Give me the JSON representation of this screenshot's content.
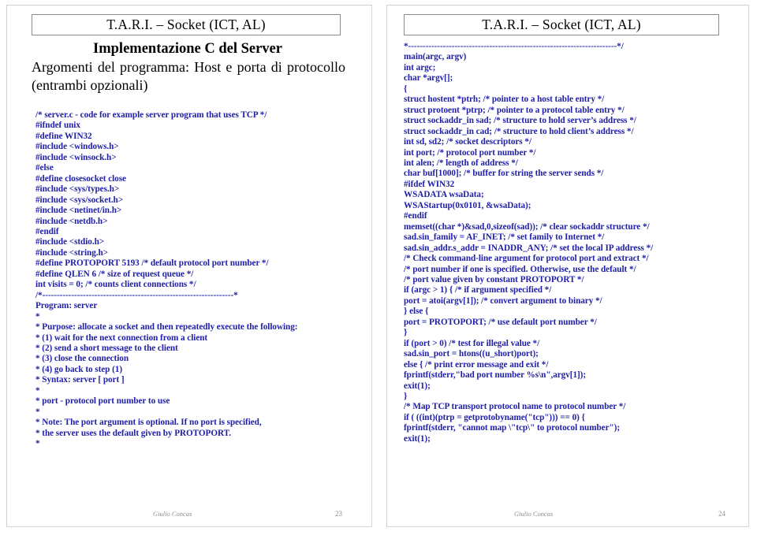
{
  "document": {
    "author": "Giulio Concas",
    "code_color": "#2020a8",
    "text_color": "#000000"
  },
  "slides": [
    {
      "header_title": "T.A.R.I. – Socket (ICT, AL)",
      "heading": "Implementazione C del Server",
      "subheading": "Argomenti del programma: Host e porta di protocollo (entrambi opzionali)",
      "page_number": "23",
      "author": "Giulio Concas",
      "code_lines": [
        "/* server.c - code for example server program that uses TCP */",
        "#ifndef unix",
        "#define WIN32",
        "#include <windows.h>",
        "#include <winsock.h>",
        "#else",
        "#define closesocket close",
        "#include <sys/types.h>",
        "#include <sys/socket.h>",
        "#include <netinet/in.h>",
        "#include <netdb.h>",
        "#endif",
        "#include <stdio.h>",
        "#include <string.h>",
        "#define PROTOPORT 5193 /* default protocol port number */",
        "#define QLEN 6 /* size of request queue */",
        "int visits = 0; /* counts client connections */",
        "/*------------------------------------------------------------------*",
        "Program: server",
        "*",
        "* Purpose: allocate a socket and then repeatedly execute the following:",
        "* (1) wait for the next connection from a client",
        "* (2) send a short message to the client",
        "* (3) close the connection",
        "* (4) go back to step (1)",
        "* Syntax: server [ port ]",
        "*",
        "* port - protocol port number to use",
        "*",
        "* Note: The port argument is optional. If no port is specified,",
        "* the server uses the default given by PROTOPORT.",
        "*"
      ]
    },
    {
      "header_title": "T.A.R.I. – Socket (ICT, AL)",
      "heading": "",
      "subheading": "",
      "page_number": "24",
      "author": "Giulio Concas",
      "code_lines": [
        "*------------------------------------------------------------------------*/",
        "main(argc, argv)",
        "int argc;",
        "char *argv[];",
        "{",
        "struct hostent *ptrh; /* pointer to a host table entry */",
        "struct protoent *ptrp; /* pointer to a protocol table entry */",
        "struct sockaddr_in sad; /* structure to hold server’s address */",
        "struct sockaddr_in cad; /* structure to hold client’s address */",
        "int sd, sd2; /* socket descriptors */",
        "int port; /* protocol port number */",
        "int alen; /* length of address */",
        "char buf[1000]; /* buffer for string the server sends */",
        "#ifdef WIN32",
        "WSADATA wsaData;",
        "WSAStartup(0x0101, &wsaData);",
        "#endif",
        "memset((char *)&sad,0,sizeof(sad)); /* clear sockaddr structure */",
        "sad.sin_family = AF_INET; /* set family to Internet */",
        "sad.sin_addr.s_addr = INADDR_ANY; /* set the local IP address */",
        "/* Check command-line argument for protocol port and extract */",
        "/* port number if one is specified. Otherwise, use the default */",
        "/* port value given by constant PROTOPORT */",
        "if (argc > 1) { /* if argument specified */",
        "port = atoi(argv[1]); /* convert argument to binary */",
        "} else {",
        "port = PROTOPORT; /* use default port number */",
        "}",
        "if (port > 0) /* test for illegal value */",
        "sad.sin_port = htons((u_short)port);",
        "else { /* print error message and exit */",
        "fprintf(stderr,\"bad port number %s\\n\",argv[1]);",
        "exit(1);",
        "}",
        "/* Map TCP transport protocol name to protocol number */",
        "if ( ((int)(ptrp = getprotobyname(\"tcp\"))) == 0) {",
        "fprintf(stderr, \"cannot map \\\"tcp\\\" to protocol number\");",
        "exit(1);"
      ]
    }
  ]
}
